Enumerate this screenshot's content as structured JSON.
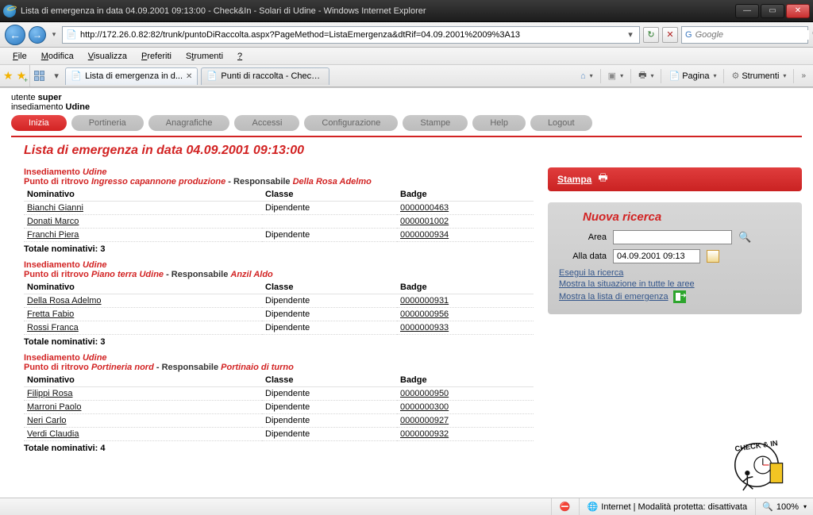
{
  "window": {
    "title": "Lista di emergenza in data 04.09.2001 09:13:00 - Check&In - Solari di Udine - Windows Internet Explorer"
  },
  "address": {
    "url": "http://172.26.0.82:82/trunk/puntoDiRaccolta.aspx?PageMethod=ListaEmergenza&dtRif=04.09.2001%2009%3A13"
  },
  "search": {
    "placeholder": "Google"
  },
  "menubar": [
    "File",
    "Modifica",
    "Visualizza",
    "Preferiti",
    "Strumenti",
    "?"
  ],
  "tabs": {
    "active": "Lista di emergenza in d...",
    "other": "Punti di raccolta - Check&..."
  },
  "toolbar": {
    "pagina": "Pagina",
    "strumenti": "Strumenti"
  },
  "page": {
    "user_prefix": "utente ",
    "user": "super",
    "inse_prefix": "insediamento ",
    "inse": "Udine",
    "nav": [
      "Inizia",
      "Portineria",
      "Anagrafiche",
      "Accessi",
      "Configurazione",
      "Stampe",
      "Help",
      "Logout"
    ],
    "title_a": "Lista di emergenza in data ",
    "title_b": "04.09.2001 09:13:00",
    "groups": [
      {
        "l1a": "Insediamento ",
        "l1b": "Udine",
        "l2a": "Punto di ritrovo ",
        "l2b": "Ingresso capannone produzione",
        "l2c": " - Responsabile ",
        "l2d": "Della Rosa Adelmo",
        "rows": [
          {
            "nom": "Bianchi Gianni",
            "cls": "Dipendente",
            "badge": "0000000463"
          },
          {
            "nom": "Donati Marco",
            "cls": "",
            "badge": "0000001002"
          },
          {
            "nom": "Franchi Piera",
            "cls": "Dipendente",
            "badge": "0000000934"
          }
        ],
        "total": "Totale nominativi: 3"
      },
      {
        "l1a": "Insediamento ",
        "l1b": "Udine",
        "l2a": "Punto di ritrovo ",
        "l2b": "Piano terra Udine",
        "l2c": " - Responsabile ",
        "l2d": "Anzil Aldo",
        "rows": [
          {
            "nom": "Della Rosa Adelmo",
            "cls": "Dipendente",
            "badge": "0000000931"
          },
          {
            "nom": "Fretta Fabio",
            "cls": "Dipendente",
            "badge": "0000000956"
          },
          {
            "nom": "Rossi Franca",
            "cls": "Dipendente",
            "badge": "0000000933"
          }
        ],
        "total": "Totale nominativi: 3"
      },
      {
        "l1a": "Insediamento ",
        "l1b": "Udine",
        "l2a": "Punto di ritrovo ",
        "l2b": "Portineria nord",
        "l2c": " - Responsabile ",
        "l2d": "Portinaio di turno",
        "rows": [
          {
            "nom": "Filippi Rosa",
            "cls": "Dipendente",
            "badge": "0000000950"
          },
          {
            "nom": "Marroni Paolo",
            "cls": "Dipendente",
            "badge": "0000000300"
          },
          {
            "nom": "Neri Carlo",
            "cls": "Dipendente",
            "badge": "0000000927"
          },
          {
            "nom": "Verdi Claudia",
            "cls": "Dipendente",
            "badge": "0000000932"
          }
        ],
        "total": "Totale nominativi: 4"
      }
    ],
    "cols": {
      "nom": "Nominativo",
      "cls": "Classe",
      "badge": "Badge"
    },
    "print_label": "Stampa",
    "search_panel": {
      "title": "Nuova ricerca",
      "area_label": "Area",
      "date_label": "Alla data",
      "date_value": "04.09.2001 09:13",
      "link1": "Esegui la ricerca",
      "link2": "Mostra la situazione in tutte le aree",
      "link3": "Mostra la lista di emergenza"
    }
  },
  "status": {
    "text": "Internet | Modalità protetta: disattivata",
    "zoom": "100%"
  }
}
